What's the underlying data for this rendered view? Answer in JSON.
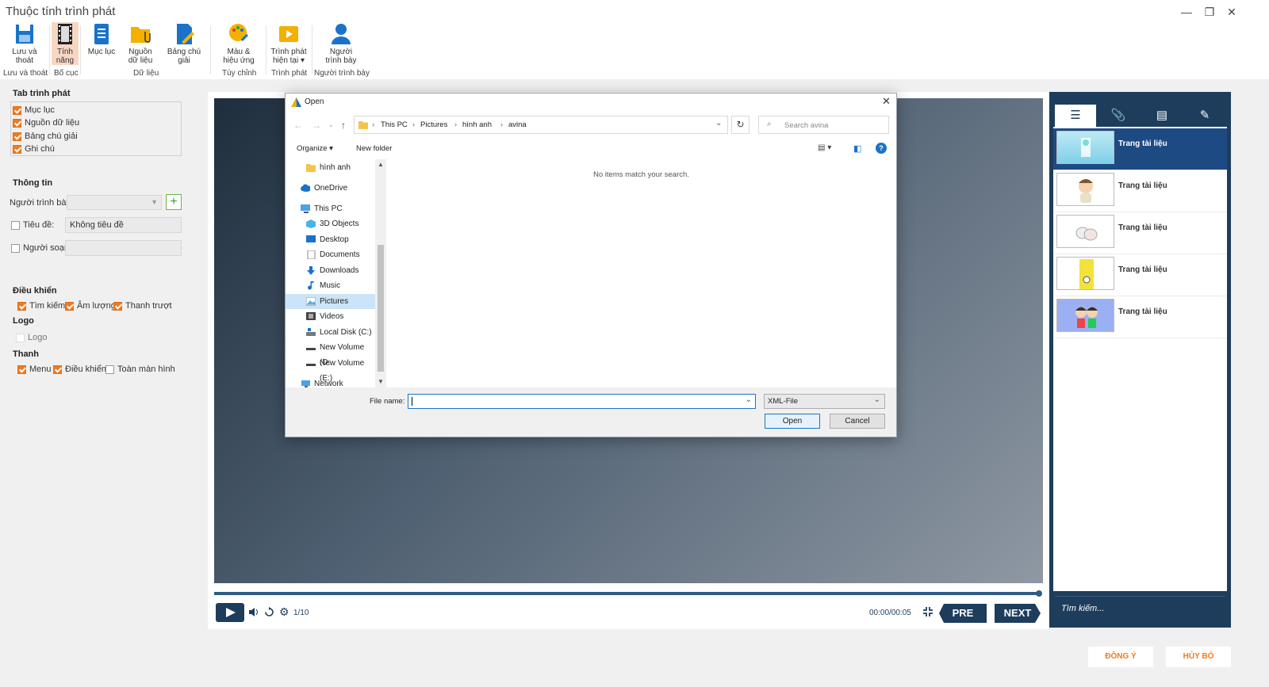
{
  "window": {
    "title": "Thuộc tính trình phát",
    "min": "—",
    "restore": "❐",
    "close": "✕"
  },
  "ribbon": {
    "buttons": [
      {
        "label": "Lưu và thoát"
      },
      {
        "label": "Tính năng"
      },
      {
        "label": "Mục lục"
      },
      {
        "label": "Nguồn dữ liệu"
      },
      {
        "label": "Bảng chú giải"
      },
      {
        "label": "Màu & hiệu ứng"
      },
      {
        "label": "Trình phát hiện tại ▾"
      },
      {
        "label": "Người trình bày"
      }
    ],
    "groups": [
      "Lưu và thoát",
      "Bố cục",
      "Dữ liệu",
      "Tùy chỉnh",
      "Trình phát",
      "Người trình bày"
    ]
  },
  "left": {
    "tab_title": "Tab trình phát",
    "tab_items": [
      "Mục lục",
      "Nguồn dữ liệu",
      "Bảng chú giải",
      "Ghi chú"
    ],
    "info_title": "Thông tin",
    "presenter_label": "Người trình bày",
    "add": "+",
    "title_label": "Tiêu đề:",
    "title_value": "Không tiêu đề",
    "author_label": "Người soạn:",
    "controls_title": "Điều khiển",
    "controls": [
      "Tìm kiếm",
      "Âm lượng",
      "Thanh trượt"
    ],
    "logo_title": "Logo",
    "logo_item": "Logo",
    "bar_title": "Thanh",
    "bar_items": [
      "Menu",
      "Điều khiển",
      "Toàn màn hình"
    ]
  },
  "player": {
    "slide": "1/10",
    "time": "00:00/00:05",
    "pre": "PRE",
    "next": "NEXT"
  },
  "sidebar": {
    "tabs": [
      "☰",
      "📎",
      "▤",
      "✎"
    ],
    "items": [
      "Trang tài liệu",
      "Trang tài liệu",
      "Trang tài liệu",
      "Trang tài liệu",
      "Trang tài liệu"
    ],
    "search_placeholder": "Tìm kiếm..."
  },
  "footer": {
    "ok": "ĐỒNG Ý",
    "cancel": "HỦY BỎ"
  },
  "dialog": {
    "title": "Open",
    "breadcrumb": [
      "This PC",
      "Pictures",
      "hình anh",
      "avina"
    ],
    "search_placeholder": "Search avina",
    "organize": "Organize ▾",
    "new_folder": "New folder",
    "help": "?",
    "empty_message": "No items match your search.",
    "nav": [
      "hình anh",
      "OneDrive",
      "This PC",
      "3D Objects",
      "Desktop",
      "Documents",
      "Downloads",
      "Music",
      "Pictures",
      "Videos",
      "Local Disk (C:)",
      "New Volume (D:",
      "New Volume (E:)",
      "Network"
    ],
    "file_name_label": "File name:",
    "file_type": "XML-File",
    "open": "Open",
    "cancel": "Cancel"
  }
}
